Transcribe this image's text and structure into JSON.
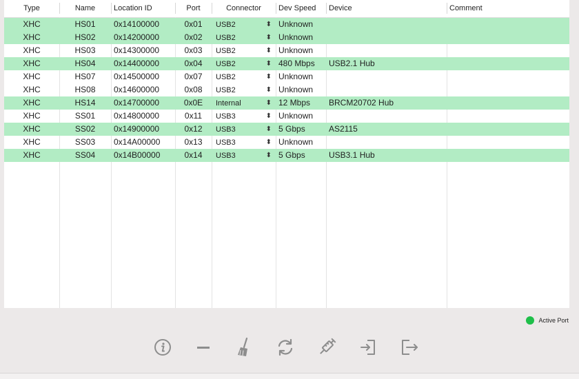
{
  "columns": [
    "Type",
    "Name",
    "Location ID",
    "Port",
    "Connector",
    "Dev Speed",
    "Device",
    "Comment"
  ],
  "rows": [
    {
      "type": "XHC",
      "name": "HS01",
      "location": "0x14100000",
      "port": "0x01",
      "connector": "USB2",
      "speed": "Unknown",
      "device": "",
      "comment": "",
      "active": true
    },
    {
      "type": "XHC",
      "name": "HS02",
      "location": "0x14200000",
      "port": "0x02",
      "connector": "USB2",
      "speed": "Unknown",
      "device": "",
      "comment": "",
      "active": true
    },
    {
      "type": "XHC",
      "name": "HS03",
      "location": "0x14300000",
      "port": "0x03",
      "connector": "USB2",
      "speed": "Unknown",
      "device": "",
      "comment": "",
      "active": false
    },
    {
      "type": "XHC",
      "name": "HS04",
      "location": "0x14400000",
      "port": "0x04",
      "connector": "USB2",
      "speed": "480 Mbps",
      "device": "USB2.1 Hub",
      "comment": "",
      "active": true
    },
    {
      "type": "XHC",
      "name": "HS07",
      "location": "0x14500000",
      "port": "0x07",
      "connector": "USB2",
      "speed": "Unknown",
      "device": "",
      "comment": "",
      "active": false
    },
    {
      "type": "XHC",
      "name": "HS08",
      "location": "0x14600000",
      "port": "0x08",
      "connector": "USB2",
      "speed": "Unknown",
      "device": "",
      "comment": "",
      "active": false
    },
    {
      "type": "XHC",
      "name": "HS14",
      "location": "0x14700000",
      "port": "0x0E",
      "connector": "Internal",
      "speed": "12 Mbps",
      "device": "BRCM20702 Hub",
      "comment": "",
      "active": true
    },
    {
      "type": "XHC",
      "name": "SS01",
      "location": "0x14800000",
      "port": "0x11",
      "connector": "USB3",
      "speed": "Unknown",
      "device": "",
      "comment": "",
      "active": false
    },
    {
      "type": "XHC",
      "name": "SS02",
      "location": "0x14900000",
      "port": "0x12",
      "connector": "USB3",
      "speed": "5 Gbps",
      "device": "AS2115",
      "comment": "",
      "active": true
    },
    {
      "type": "XHC",
      "name": "SS03",
      "location": "0x14A00000",
      "port": "0x13",
      "connector": "USB3",
      "speed": "Unknown",
      "device": "",
      "comment": "",
      "active": false
    },
    {
      "type": "XHC",
      "name": "SS04",
      "location": "0x14B00000",
      "port": "0x14",
      "connector": "USB3",
      "speed": "5 Gbps",
      "device": "USB3.1 Hub",
      "comment": "",
      "active": true
    }
  ],
  "legend": {
    "label": "Active Port",
    "color": "#1fbf4a"
  },
  "active_row_color": "#b2ecc4",
  "toolbar": [
    {
      "name": "info-button",
      "icon": "info-circle-icon"
    },
    {
      "name": "remove-button",
      "icon": "minus-icon"
    },
    {
      "name": "clear-button",
      "icon": "broom-icon"
    },
    {
      "name": "refresh-button",
      "icon": "refresh-icon"
    },
    {
      "name": "inject-button",
      "icon": "syringe-icon"
    },
    {
      "name": "import-button",
      "icon": "import-icon"
    },
    {
      "name": "export-button",
      "icon": "export-icon"
    }
  ]
}
